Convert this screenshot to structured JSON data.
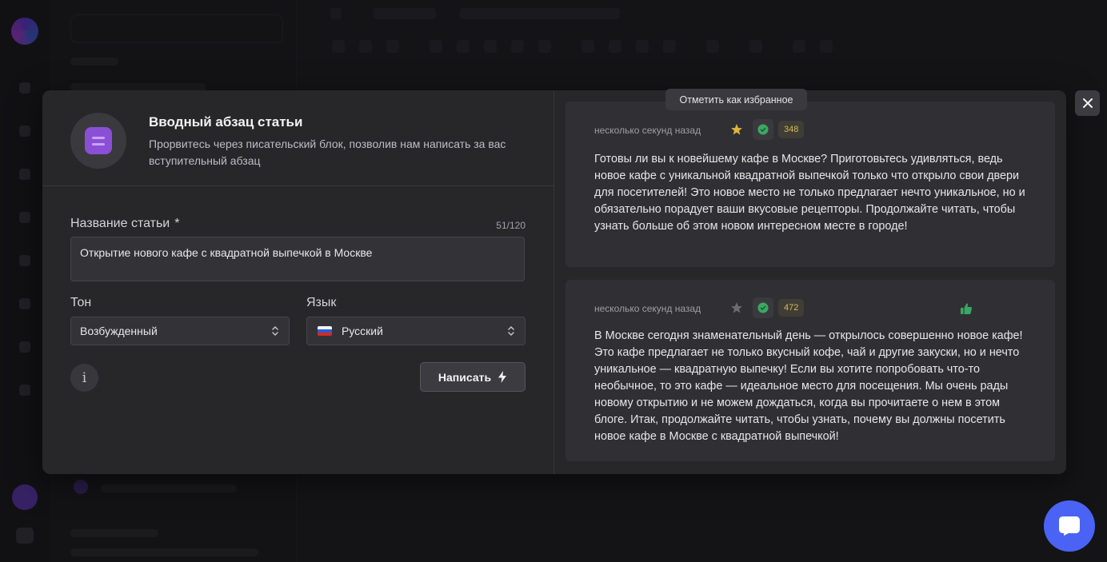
{
  "modal": {
    "tool_icon": "document-lines-icon",
    "title": "Вводный абзац статьи",
    "description": "Прорвитесь через писательский блок, позволив нам написать за вас вступительный абзац",
    "article_label": "Название статьи",
    "required_mark": "*",
    "counter": "51/120",
    "article_value": "Открытие нового кафе с квадратной выпечкой в Москве",
    "tone_label": "Тон",
    "tone_value": "Возбужденный",
    "language_label": "Язык",
    "language_value": "Русский",
    "language_flag": "russia-flag-icon",
    "info_glyph": "i",
    "write_label": "Написать",
    "write_icon": "lightning-icon"
  },
  "results": [
    {
      "timestamp": "несколько секунд назад",
      "favorite": true,
      "score": "348",
      "liked": false,
      "text": "Готовы ли вы к новейшему кафе в Москве? Приготовьтесь удивляться, ведь новое кафе с уникальной квадратной выпечкой только что открыло свои двери для посетителей! Это новое место не только предлагает нечто уникальное, но и обязательно порадует ваши вкусовые рецепторы. Продолжайте читать, чтобы узнать больше об этом новом интересном месте в городе!"
    },
    {
      "timestamp": "несколько секунд назад",
      "favorite": false,
      "score": "472",
      "liked": true,
      "text": "В Москве сегодня знаменательный день — открылось совершенно новое кафе! Это кафе предлагает не только вкусный кофе, чай и другие закуски, но и нечто уникальное — квадратную выпечку! Если вы хотите попробовать что-то необычное, то это кафе — идеальное место для посещения. Мы очень рады новому открытию и не можем дождаться, когда вы прочитаете о нем в этом блоге. Итак, продолжайте читать, чтобы узнать, почему вы должны посетить новое кафе в Москве с квадратной выпечкой!"
    }
  ],
  "tooltip": "Отметить как избранное",
  "colors": {
    "accent_purple": "#8b4fd6",
    "star_active": "#e0b43a",
    "check_green": "#3aa865",
    "score_text": "#d8b95a",
    "chat_blue": "#4a63f5"
  }
}
